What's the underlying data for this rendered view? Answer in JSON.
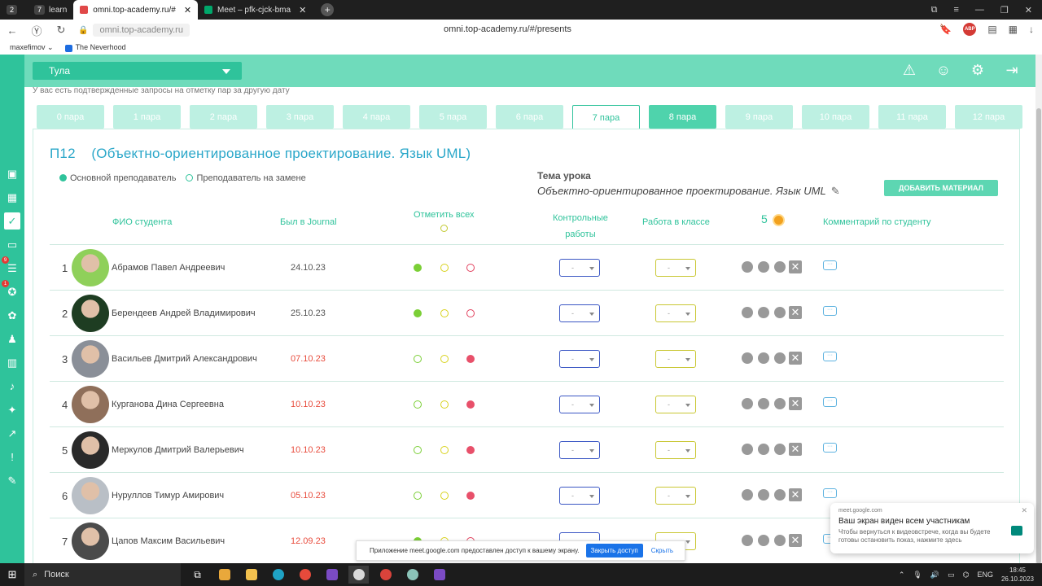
{
  "browser": {
    "tabs": [
      {
        "label": "2",
        "badge": "2",
        "kind": "workspace"
      },
      {
        "label": "learn",
        "badge": "7",
        "kind": "group"
      },
      {
        "label": "omni.top-academy.ru/#",
        "kind": "page",
        "active": true
      },
      {
        "label": "Meet – pfk-cjck-bma",
        "kind": "page"
      }
    ],
    "url_short": "omni.top-academy.ru",
    "url_full": "omni.top-academy.ru/#/presents",
    "bookmarks": [
      "maxefimov",
      "The Neverhood"
    ],
    "extension_abp": "ABP"
  },
  "app": {
    "city": "Тула",
    "notice": "У вас есть подтвержденные запросы на отметку пар за другую дату",
    "pairs": [
      "0 пара",
      "1 пара",
      "2 пара",
      "3 пара",
      "4 пара",
      "5 пара",
      "6 пара",
      "7 пара",
      "8 пара",
      "9 пара",
      "10 пара",
      "11 пара",
      "12 пара"
    ],
    "current_pair": "7 пара",
    "group_title": "П12    (Объектно-ориентированное проектирование. Язык UML)",
    "legend": {
      "main": "Основной преподаватель",
      "substitute": "Преподаватель на замене"
    },
    "topic_label": "Тема урока",
    "topic_value": "Объектно-ориентированное проектирование. Язык UML",
    "add_material": "ДОБАВИТЬ МАТЕРИАЛ",
    "columns": {
      "name": "ФИО студента",
      "journal": "Был в Journal",
      "mark_all": "Отметить всех",
      "tests_1": "Контрольные",
      "tests_2": "работы",
      "classwork": "Работа в классе",
      "coins": "5",
      "comment": "Комментарий по студенту"
    },
    "select_placeholder": "-",
    "students": [
      {
        "n": "1",
        "name": "Абрамов Павел Андреевич",
        "date": "24.10.23",
        "late": false,
        "presence": [
          "green-f",
          "yellow-o",
          "red-o"
        ]
      },
      {
        "n": "2",
        "name": "Берендеев Андрей Владимирович",
        "date": "25.10.23",
        "late": false,
        "presence": [
          "green-f",
          "yellow-o",
          "red-o"
        ]
      },
      {
        "n": "3",
        "name": "Васильев Дмитрий Александрович",
        "date": "07.10.23",
        "late": true,
        "presence": [
          "green-o",
          "yellow-o",
          "red-f"
        ]
      },
      {
        "n": "4",
        "name": "Курганова Дина Сергеевна",
        "date": "10.10.23",
        "late": true,
        "presence": [
          "green-o",
          "yellow-o",
          "red-f"
        ]
      },
      {
        "n": "5",
        "name": "Меркулов Дмитрий Валерьевич",
        "date": "10.10.23",
        "late": true,
        "presence": [
          "green-o",
          "yellow-o",
          "red-f"
        ]
      },
      {
        "n": "6",
        "name": "Нуруллов Тимур Амирович",
        "date": "05.10.23",
        "late": true,
        "presence": [
          "green-o",
          "yellow-o",
          "red-f"
        ]
      },
      {
        "n": "7",
        "name": "Цапов Максим Васильевич",
        "date": "12.09.23",
        "late": true,
        "presence": [
          "green-f",
          "yellow-o",
          "red-o"
        ]
      }
    ]
  },
  "overlays": {
    "share_text": "Приложение meet.google.com предоставлен доступ к вашему экрану.",
    "share_stop": "Закрыть доступ",
    "share_hide": "Скрыть",
    "meet_source": "meet.google.com",
    "meet_title": "Ваш экран виден всем участникам",
    "meet_text": "Чтобы вернуться к видеовстрече, когда вы будете готовы остановить показ, нажмите здесь"
  },
  "taskbar": {
    "search": "Поиск",
    "lang": "ENG",
    "time": "18:45",
    "date": "26.10.2023"
  },
  "colors": {
    "accent": "#2fc39b",
    "topbar": "#6fdbbb",
    "title": "#2aa7c9",
    "late_date": "#e84c3d"
  }
}
